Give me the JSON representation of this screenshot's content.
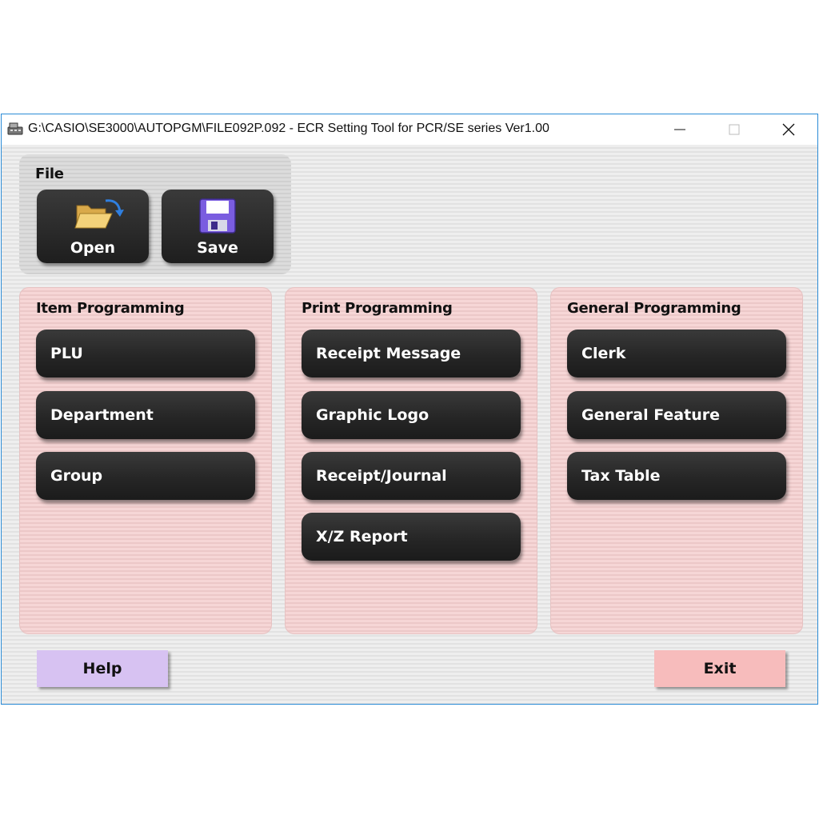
{
  "window": {
    "title": "G:\\CASIO\\SE3000\\AUTOPGM\\FILE092P.092 - ECR Setting Tool for PCR/SE series Ver1.00",
    "app_icon": "cash-register-icon",
    "controls": [
      "minimize-icon",
      "maximize-icon",
      "close-icon"
    ]
  },
  "file_panel": {
    "title": "File",
    "open_label": "Open",
    "save_label": "Save",
    "open_icon": "open-folder-icon",
    "save_icon": "floppy-disk-icon"
  },
  "item_programming": {
    "title": "Item Programming",
    "buttons": [
      "PLU",
      "Department",
      "Group"
    ]
  },
  "print_programming": {
    "title": "Print Programming",
    "buttons": [
      "Receipt Message",
      "Graphic Logo",
      "Receipt/Journal",
      "X/Z Report"
    ]
  },
  "general_programming": {
    "title": "General Programming",
    "buttons": [
      "Clerk",
      "General Feature",
      "Tax Table"
    ]
  },
  "footer": {
    "help_label": "Help",
    "exit_label": "Exit"
  },
  "colors": {
    "window_border": "#2a8bd6",
    "panel_pink": "#f6d6d6",
    "button_dark": "#262626",
    "help_purple": "#d7c2f2",
    "exit_pink": "#f7bcbc"
  }
}
